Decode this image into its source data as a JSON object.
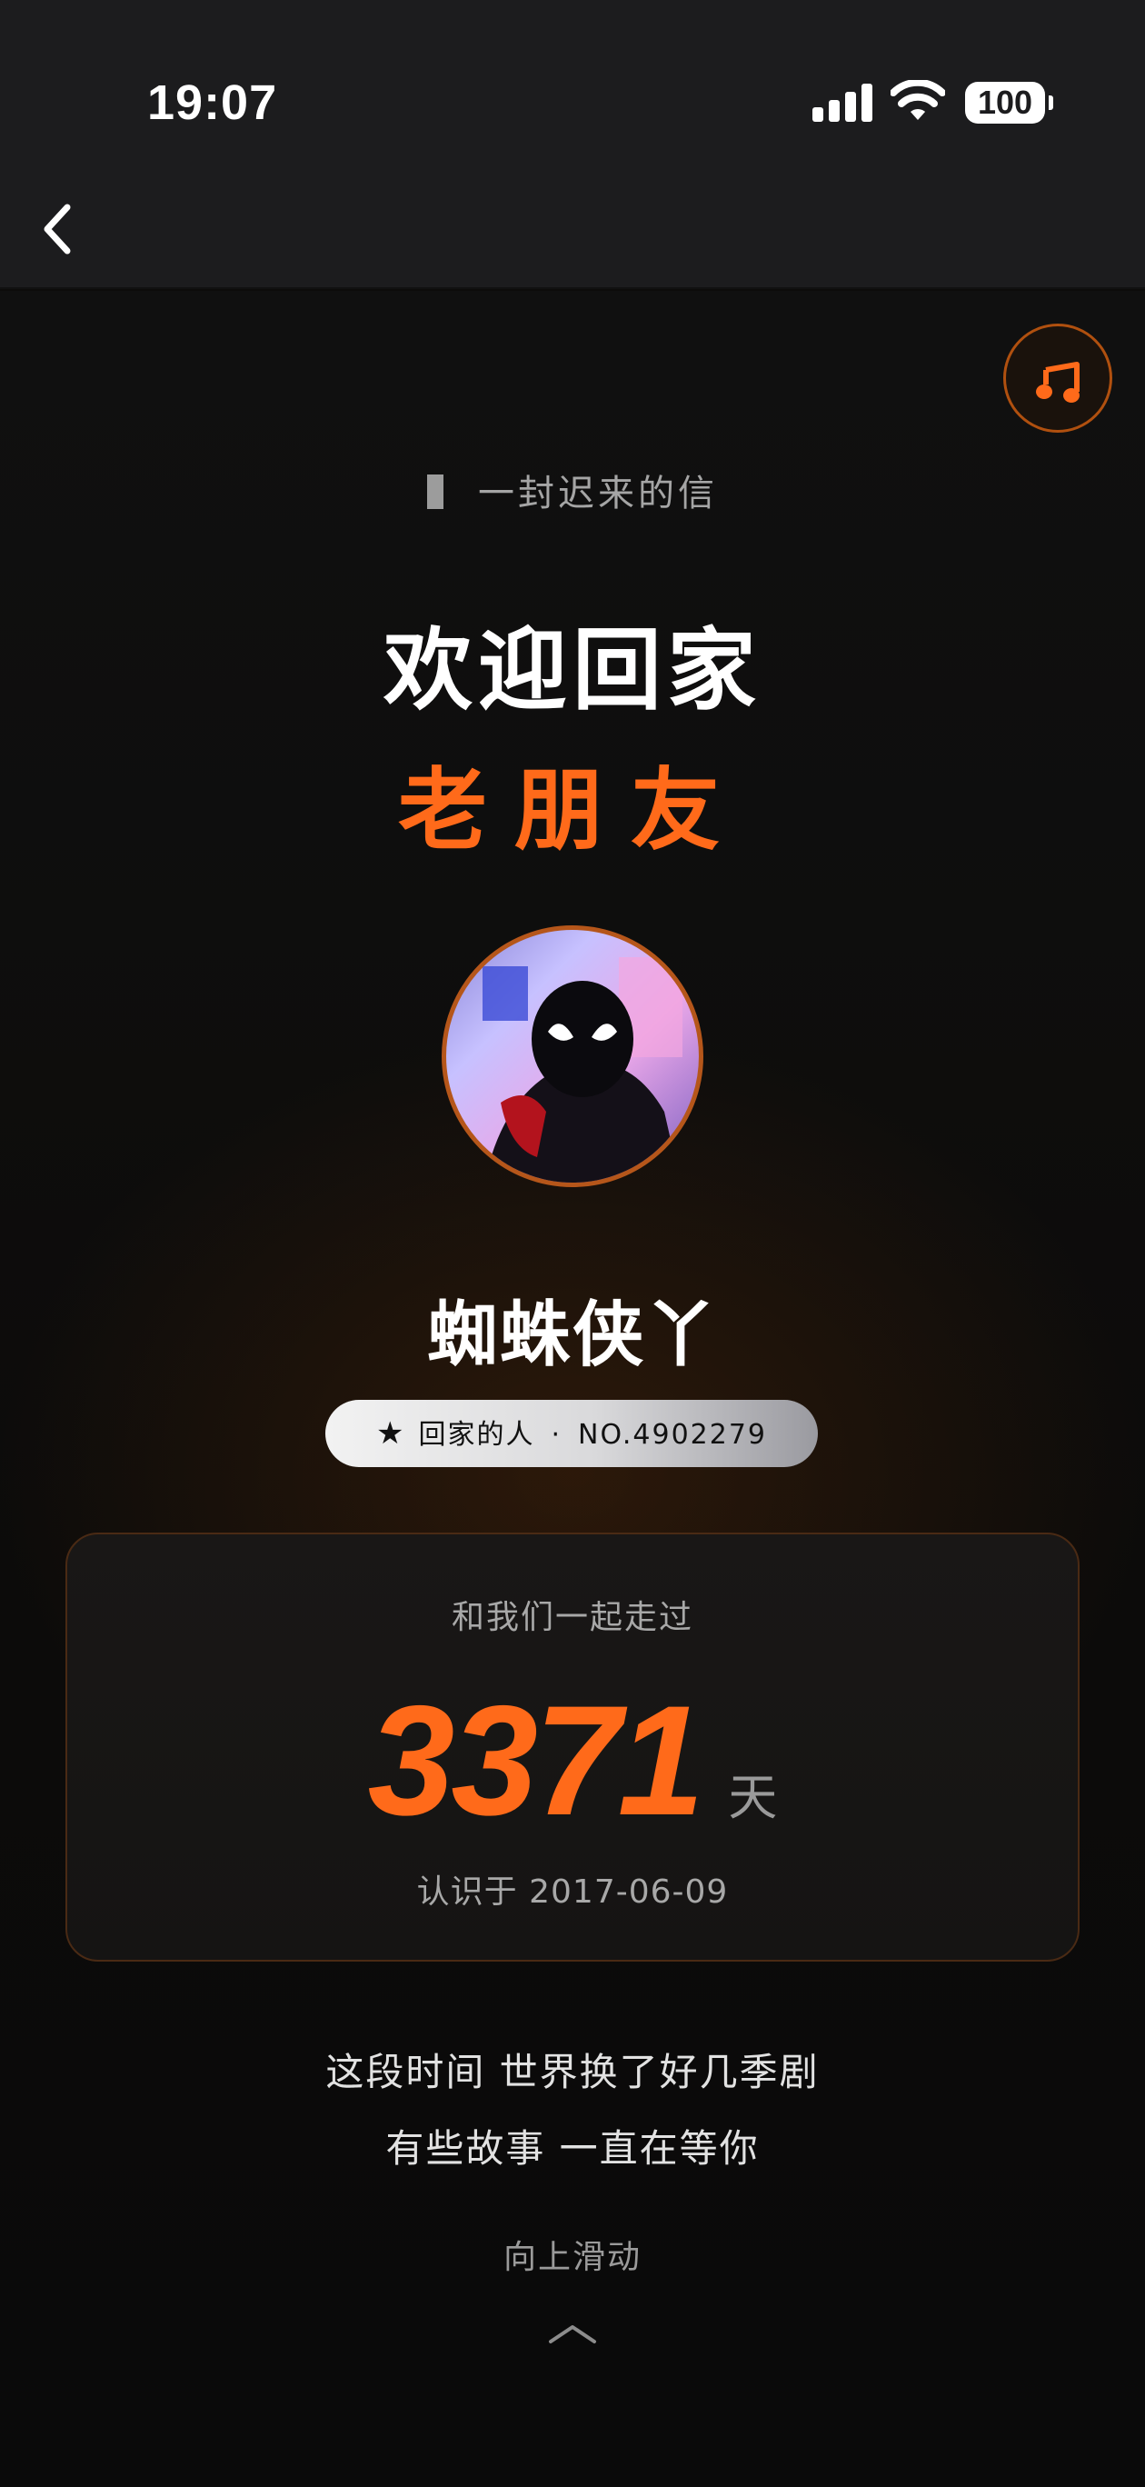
{
  "status_bar": {
    "time": "19:07",
    "battery": "100",
    "icons": [
      "signal-icon",
      "wifi-icon",
      "battery-icon"
    ]
  },
  "nav": {
    "back_icon": "chevron-left-icon"
  },
  "music_button": {
    "icon": "music-note-icon",
    "accent": "#ff6a1a"
  },
  "header": {
    "eyebrow": "一封迟来的信",
    "title": "欢迎回家",
    "subtitle": "老朋友"
  },
  "profile": {
    "nickname": "蜘蛛侠丫",
    "badge_label": "回家的人",
    "badge_number": "NO.4902279"
  },
  "stats": {
    "label": "和我们一起走过",
    "days": "3371",
    "unit": "天",
    "since": "认识于 2017-06-09"
  },
  "message": {
    "line1": "这段时间 世界换了好几季剧",
    "line2": "有些故事 一直在等你"
  },
  "footer": {
    "hint": "向上滑动",
    "arrow_icon": "chevron-up-icon"
  },
  "colors": {
    "accent": "#ff6a1a",
    "background": "#0d0c0b",
    "card_border": "#4a2a14"
  }
}
